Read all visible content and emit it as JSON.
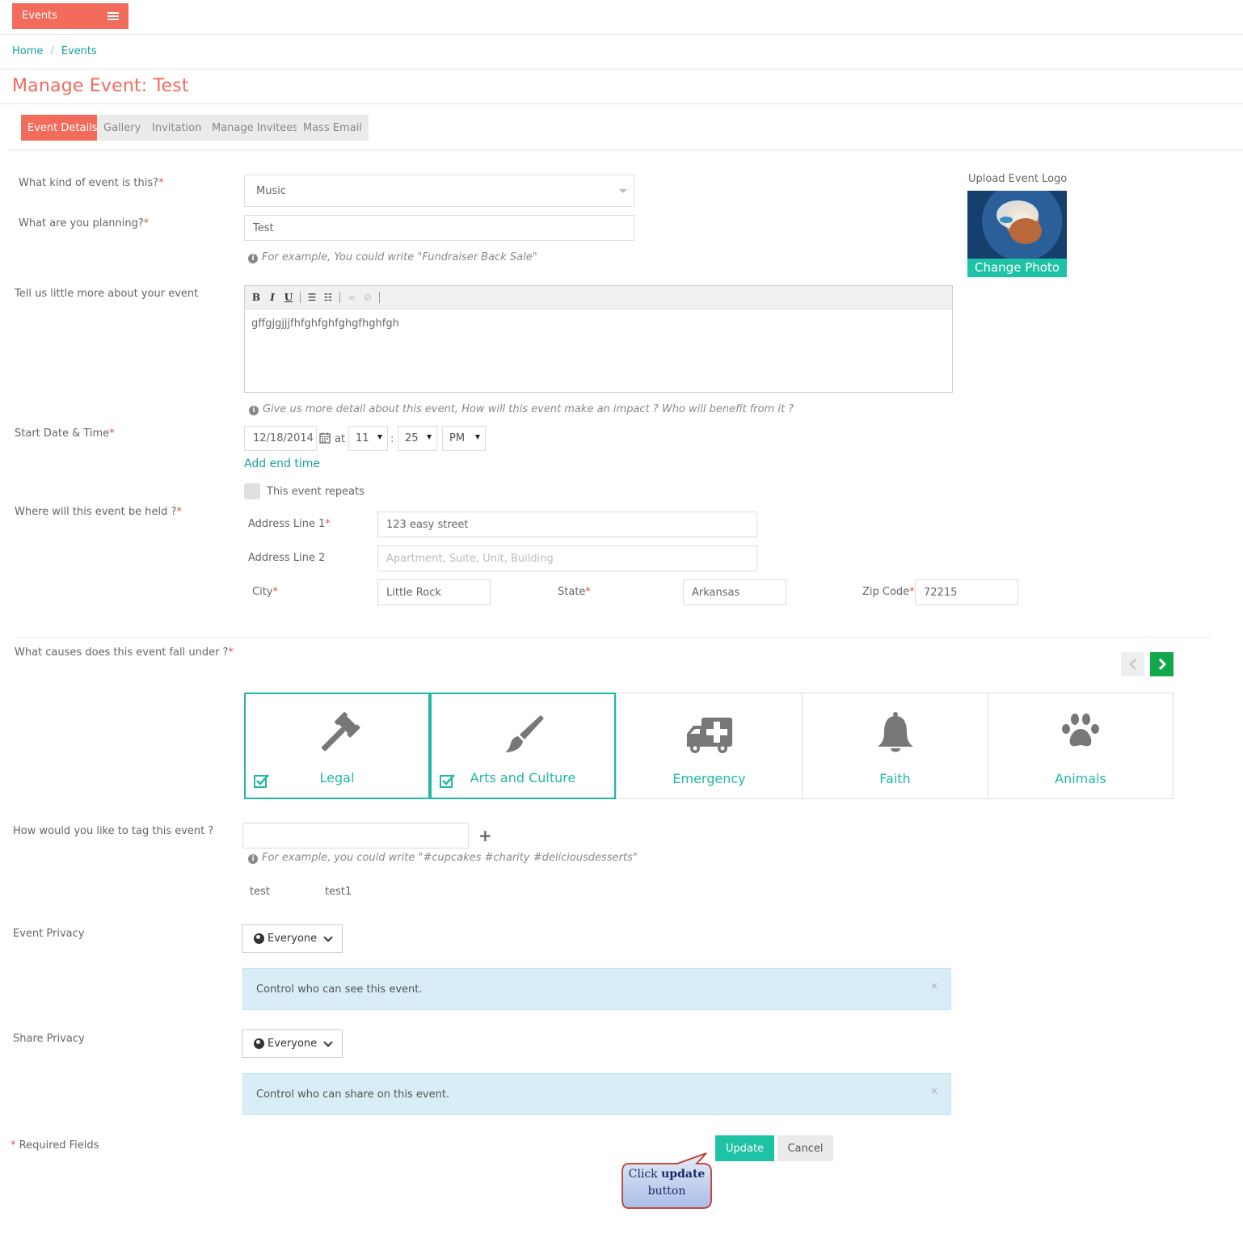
{
  "header": {
    "menu_button": "Events"
  },
  "breadcrumb": {
    "home": "Home",
    "separator": "/",
    "current": "Events"
  },
  "page_title": "Manage Event: Test",
  "tabs": [
    {
      "label": "Event Details",
      "active": true
    },
    {
      "label": "Gallery",
      "active": false
    },
    {
      "label": "Invitation",
      "active": false
    },
    {
      "label": "Manage Invitees",
      "active": false
    },
    {
      "label": "Mass Email",
      "active": false
    }
  ],
  "form": {
    "event_kind": {
      "label": "What kind of event is this?",
      "required": "*",
      "value": "Music"
    },
    "planning": {
      "label": "What are you planning?",
      "required": "*",
      "value": "Test",
      "hint": "For example, You could write \"Fundraiser Back Sale\""
    },
    "description": {
      "label": "Tell us little more about your event",
      "toolbar": {
        "bold": "B",
        "italic": "I",
        "underline": "U"
      },
      "value": "gffgjgjjjfhfghfghfghgfhghfgh",
      "hint": "Give us more detail about this event, How will this event make an impact ? Who will benefit from it ?"
    },
    "start": {
      "label": "Start Date & Time",
      "required": "*",
      "date": "12/18/2014",
      "at": "at",
      "hour": "11",
      "colon": ":",
      "minute": "25",
      "ampm": "PM",
      "add_end_time": "Add end time"
    },
    "repeats": {
      "label": "This event repeats",
      "checked": false
    },
    "location": {
      "label": "Where will this event be held ?",
      "required": "*",
      "address1_label": "Address Line 1",
      "address1_value": "123 easy street",
      "address2_label": "Address Line 2",
      "address2_placeholder": "Apartment, Suite, Unit, Building",
      "city_label": "City",
      "city_value": "Little Rock",
      "state_label": "State",
      "state_value": "Arkansas",
      "zip_label": "Zip Code",
      "zip_value": "72215"
    },
    "causes": {
      "label": "What causes does this event fall under ?",
      "required": "*",
      "items": [
        {
          "name": "Legal",
          "icon": "gavel-icon",
          "selected": true
        },
        {
          "name": "Arts and Culture",
          "icon": "paintbrush-icon",
          "selected": true
        },
        {
          "name": "Emergency",
          "icon": "ambulance-icon",
          "selected": false
        },
        {
          "name": "Faith",
          "icon": "bell-icon",
          "selected": false
        },
        {
          "name": "Animals",
          "icon": "paw-icon",
          "selected": false
        }
      ]
    },
    "tags": {
      "label": "How would you like to tag this event ?",
      "value": "",
      "add": "+",
      "hint": "For example, you could write \"#cupcakes #charity #deliciousdesserts\"",
      "items": [
        "test",
        "test1"
      ]
    },
    "event_privacy": {
      "label": "Event Privacy",
      "value": "Everyone",
      "info": "Control who can see this event.",
      "close": "×"
    },
    "share_privacy": {
      "label": "Share Privacy",
      "value": "Everyone",
      "info": "Control who can share on this event.",
      "close": "×"
    },
    "required_note": {
      "star": "*",
      "text": "Required Fields"
    },
    "buttons": {
      "update": "Update",
      "cancel": "Cancel"
    }
  },
  "logo": {
    "label": "Upload Event Logo",
    "change": "Change Photo"
  },
  "callout": {
    "line1_pre": "Click ",
    "line1_bold": "update",
    "line2": "button"
  },
  "colors": {
    "brand": "#f26b5b",
    "accent": "#1ec2a5",
    "link": "#1aa0a0",
    "info_bg": "#d9edf7"
  }
}
